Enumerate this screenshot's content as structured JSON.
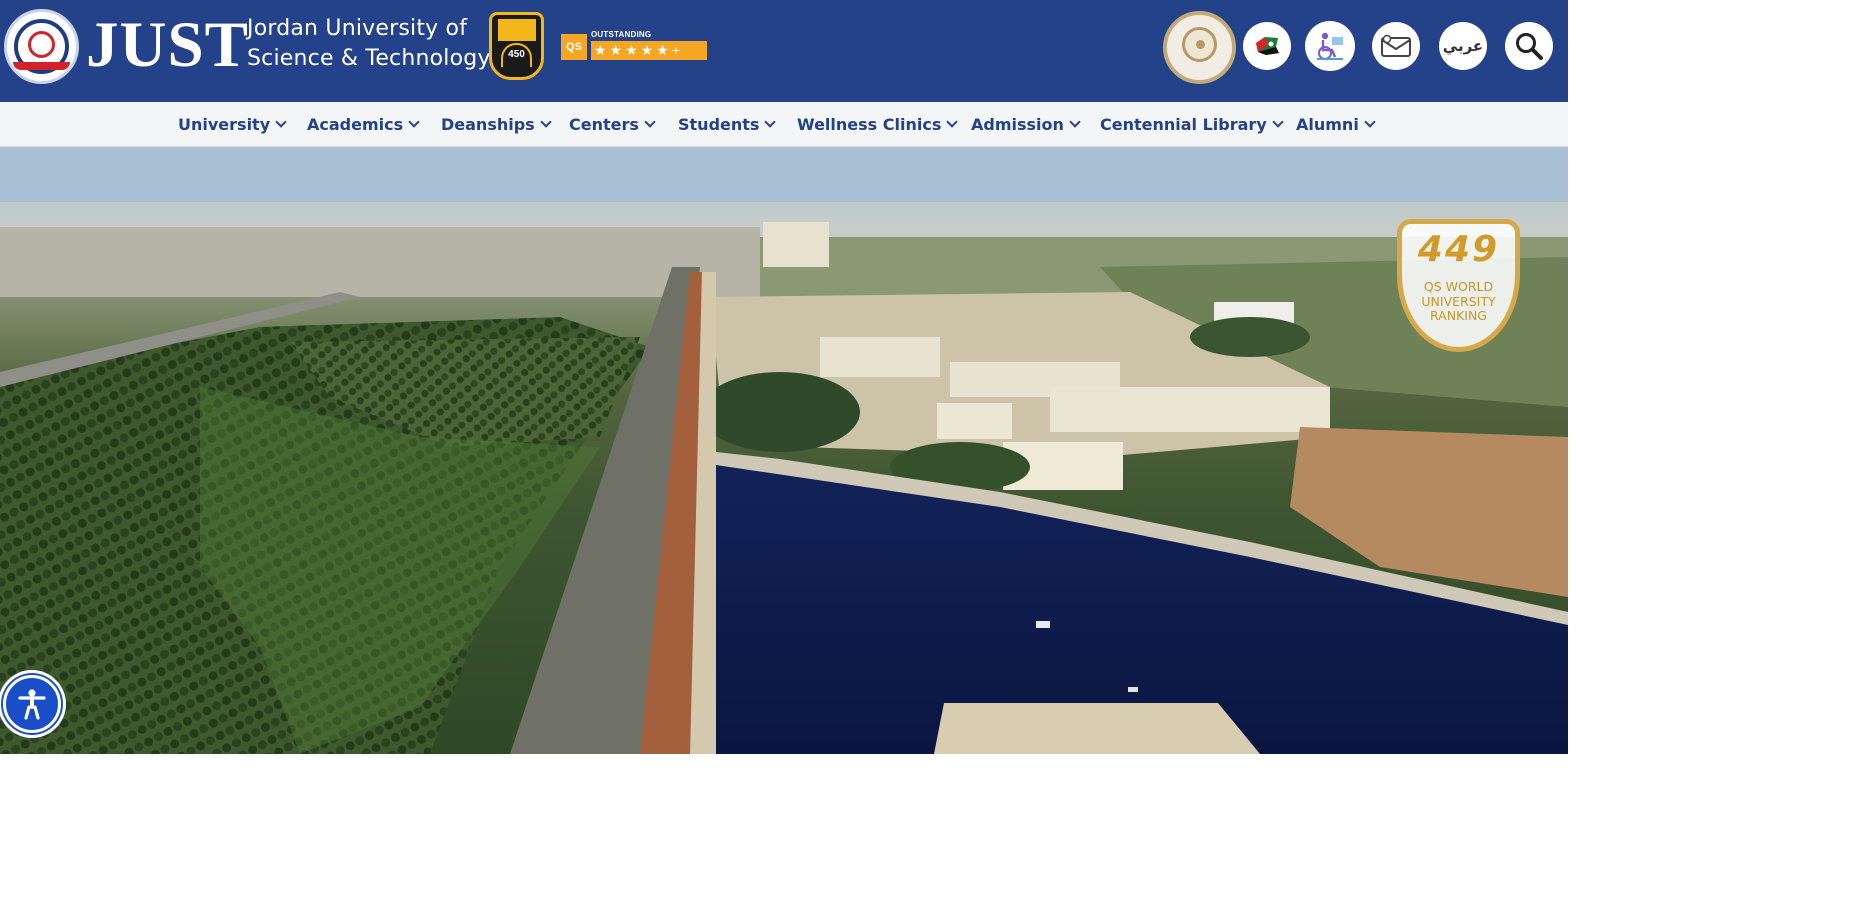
{
  "header": {
    "logo_abbr": "JUST",
    "university_name_line1": "Jordan University of",
    "university_name_line2": "Science & Technology",
    "ranking_badge_number": "450",
    "qs_badge": {
      "mark": "QS",
      "label": "OUTSTANDING",
      "stars": "★★★★★+"
    },
    "arabic_link": "عربي",
    "icons": [
      "seal-of-excellence-icon",
      "gaza-support-icon",
      "accessibility-services-icon",
      "email-icon",
      "search-icon"
    ]
  },
  "nav": {
    "items": [
      {
        "label": "University"
      },
      {
        "label": "Academics"
      },
      {
        "label": "Deanships"
      },
      {
        "label": "Centers"
      },
      {
        "label": "Students"
      },
      {
        "label": "Wellness Clinics"
      },
      {
        "label": "Admission"
      },
      {
        "label": "Centennial Library"
      },
      {
        "label": "Alumni"
      }
    ]
  },
  "hero": {
    "qs_ranking": {
      "number": "449",
      "line1": "QS WORLD",
      "line2": "UNIVERSITY",
      "line3": "RANKING"
    }
  },
  "colors": {
    "header_bg": "#23428a",
    "nav_text": "#23428a",
    "accent_gold": "#d7a84a",
    "accessibility_blue": "#1a4ec8"
  }
}
